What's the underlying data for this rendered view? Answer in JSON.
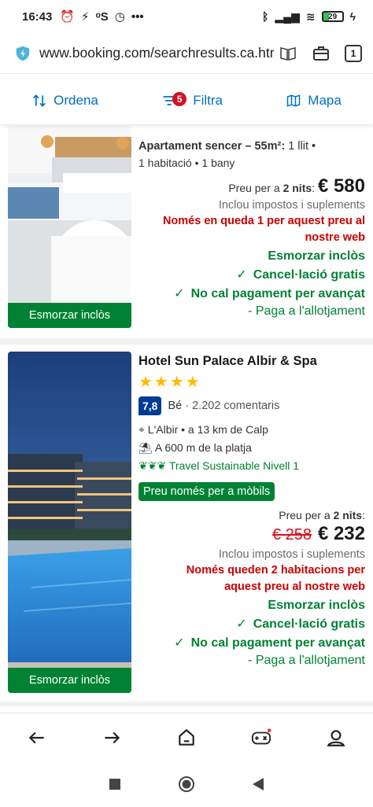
{
  "status": {
    "time": "16:43",
    "battery": "29",
    "battery_level": 0.29
  },
  "browser": {
    "url": "www.booking.com/searchresults.ca.htr",
    "tab_count": "1"
  },
  "toolbar": {
    "sort": "Ordena",
    "filter": "Filtra",
    "filter_count": "5",
    "map": "Mapa"
  },
  "listing1": {
    "type": "Apartament sencer – 55m²:",
    "beds": "1 llit •",
    "rooms": "1 habitació • 1 bany",
    "price_prefix": "Preu per a",
    "nights": "2 nits",
    "price": "€ 580",
    "taxes": "Inclou impostos i suplements",
    "scarcity": "Només en queda 1 per aquest preu al nostre web",
    "breakfast": "Esmorzar inclòs",
    "cancel": "Cancel·lació gratis",
    "prepay": "No cal pagament per avançat",
    "pay": "- Paga a l'allotjament",
    "photo_tag": "Esmorzar inclòs"
  },
  "listing2": {
    "name": "Hotel Sun Palace Albir & Spa",
    "stars": "★★★★",
    "score": "7,8",
    "score_label": "Bé",
    "reviews": "· 2.202 comentaris",
    "location": "L'Albir • a 13 km de Calp",
    "beach": "A 600 m de la platja",
    "sustainable": "Travel Sustainable Nivell 1",
    "mobile_deal": "Preu només per a mòbils",
    "price_prefix": "Preu per a",
    "nights": "2 nits",
    "old_price": "€ 258",
    "price": "€ 232",
    "taxes": "Inclou impostos i suplements",
    "scarcity": "Només queden 2 habitacions per aquest preu al nostre web",
    "breakfast": "Esmorzar inclòs",
    "cancel": "Cancel·lació gratis",
    "prepay": "No cal pagament per avançat",
    "pay": "- Paga a l'allotjament",
    "photo_tag": "Esmorzar inclòs"
  },
  "colors": {
    "brand_blue": "#0071c2",
    "green": "#008234",
    "red": "#c00",
    "score_blue": "#003b95"
  }
}
